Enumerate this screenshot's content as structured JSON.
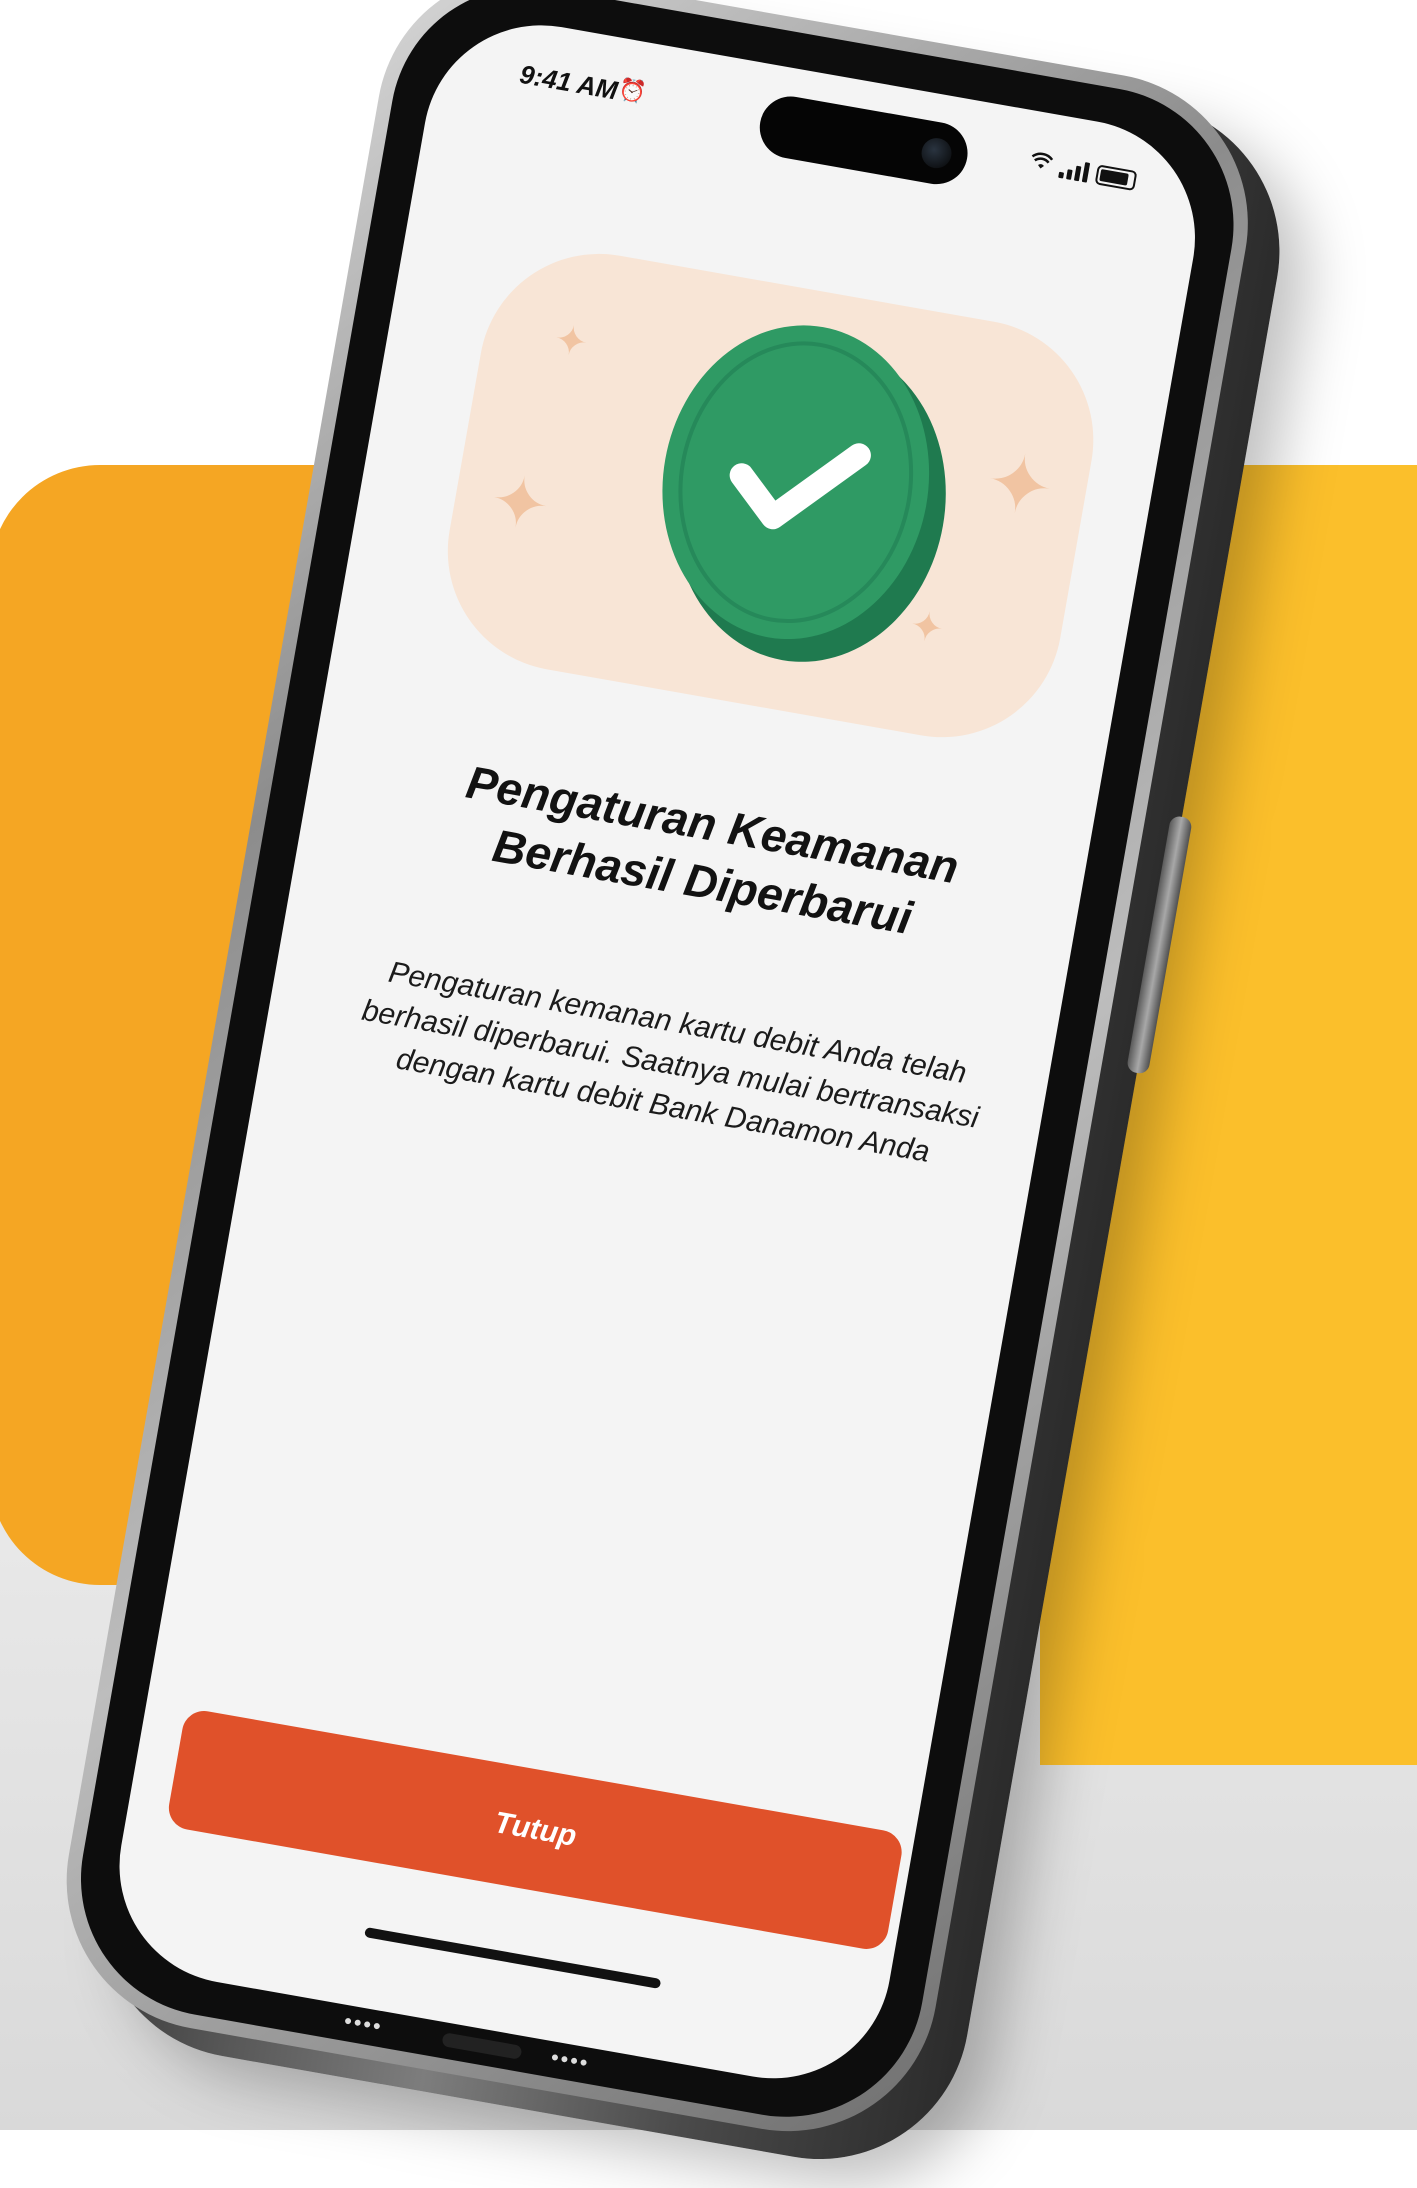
{
  "status_bar": {
    "time": "9:41 AM",
    "alarm_icon": "alarm-clock-icon",
    "wifi_icon": "wifi-icon",
    "signal_icon": "cellular-signal-icon",
    "battery_icon": "battery-icon"
  },
  "illustration": {
    "icon": "check-icon",
    "badge_color": "#2f9a64",
    "background_color": "#f8e5d6"
  },
  "title": "Pengaturan Keamanan Berhasil Diperbarui",
  "description": "Pengaturan kemanan kartu debit Anda telah berhasil diperbarui. Saatnya mulai bertransaksi dengan kartu debit Bank Danamon Anda",
  "close_button": {
    "label": "Tutup",
    "color": "#e0512a"
  },
  "colors": {
    "accent_orange": "#f5a623",
    "accent_yellow": "#fbbf2b"
  }
}
